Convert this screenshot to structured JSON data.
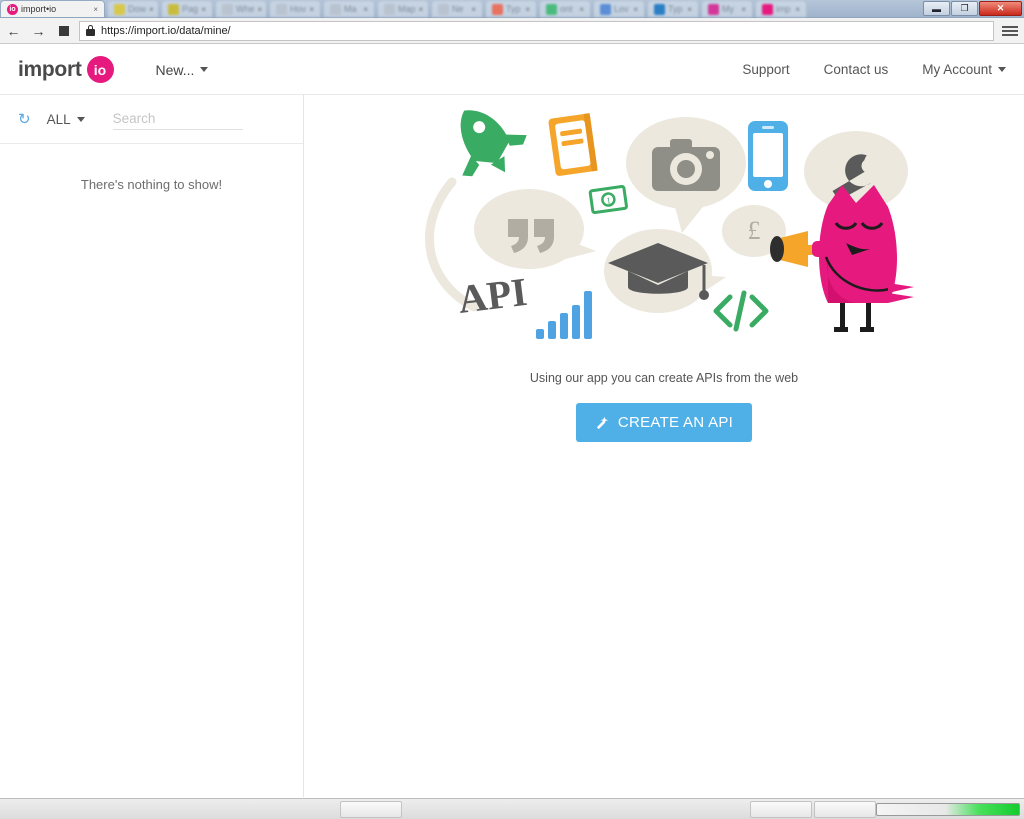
{
  "browser": {
    "active_tab": {
      "title": "import•io",
      "favicon": "io-favicon",
      "close_label": "×"
    },
    "background_tabs": [
      {
        "title": "Dow",
        "close_label": "×",
        "color": "#d8c84a"
      },
      {
        "title": "Pag",
        "close_label": "×",
        "color": "#c9bc3d"
      },
      {
        "title": "Whe",
        "close_label": "×",
        "color": "#b9c3cf"
      },
      {
        "title": "Hov",
        "close_label": "×",
        "color": "#b9c3cf"
      },
      {
        "title": "Ma",
        "close_label": "×",
        "color": "#b9c3cf"
      },
      {
        "title": "Map",
        "close_label": "×",
        "color": "#b9c3cf"
      },
      {
        "title": "Ne",
        "close_label": "×",
        "color": "#b9c3cf"
      },
      {
        "title": "Typ",
        "close_label": "×",
        "color": "#e8715f"
      },
      {
        "title": "ont",
        "close_label": "×",
        "color": "#4bbb7d"
      },
      {
        "title": "Lov",
        "close_label": "×",
        "color": "#5b8ed6"
      },
      {
        "title": "Typ",
        "close_label": "×",
        "color": "#2b7fc4"
      },
      {
        "title": "My",
        "close_label": "×",
        "color": "#d4379a"
      },
      {
        "title": "imp",
        "close_label": "×",
        "color": "#e6197f"
      }
    ],
    "window_controls": {
      "minimize": "▬",
      "restore": "❐",
      "close": "✕"
    },
    "toolbar": {
      "back_label": "←",
      "forward_label": "→",
      "stop_label": "stop",
      "url": "https://import.io/data/mine/",
      "lock_label": "secure-connection",
      "menu_label": "≡"
    }
  },
  "app": {
    "logo": {
      "word": "import",
      "badge": "io",
      "badge_color": "#e6197f"
    },
    "new_menu": {
      "label": "New...",
      "caret": "▾"
    },
    "header_links": [
      {
        "label": "Support",
        "caret": ""
      },
      {
        "label": "Contact us",
        "caret": ""
      },
      {
        "label": "My Account",
        "caret": "▾"
      }
    ]
  },
  "sidebar": {
    "refresh_icon": "refresh-icon",
    "filter": {
      "label": "ALL",
      "caret": "▾"
    },
    "search": {
      "value": "",
      "placeholder": "Search"
    },
    "empty_message": "There's nothing to show!"
  },
  "main": {
    "illustration": {
      "alt": "api-illustration",
      "elements": [
        "rocket",
        "book",
        "camera-bubble",
        "smartphone",
        "wrench-bubble",
        "quote-bubble",
        "dollar-bill",
        "pound-bubble",
        "graduation-cap-bubble",
        "bar-chart",
        "code-brackets",
        "API-wordmark",
        "owl-with-trumpet"
      ],
      "wordmark": "API",
      "code_glyph": "</>",
      "currency_glyph": "£",
      "colors": {
        "rocket": "#3aab63",
        "book": "#f5a52a",
        "phone": "#4fb0e8",
        "bars": "#4fa3e3",
        "money": "#3aab63",
        "code": "#3aab63",
        "bubble": "#ece8de",
        "gray_icon": "#8f8f87",
        "owl": "#e6197f",
        "trumpet": "#f5a52a"
      }
    },
    "caption": "Using our app you can create APIs from the web",
    "cta": {
      "label": "CREATE AN API",
      "icon": "magic-wand-icon",
      "color": "#4fb0e8"
    }
  },
  "taskbar": {
    "progress_label": "download-progress",
    "items": [
      "",
      "",
      ""
    ]
  }
}
